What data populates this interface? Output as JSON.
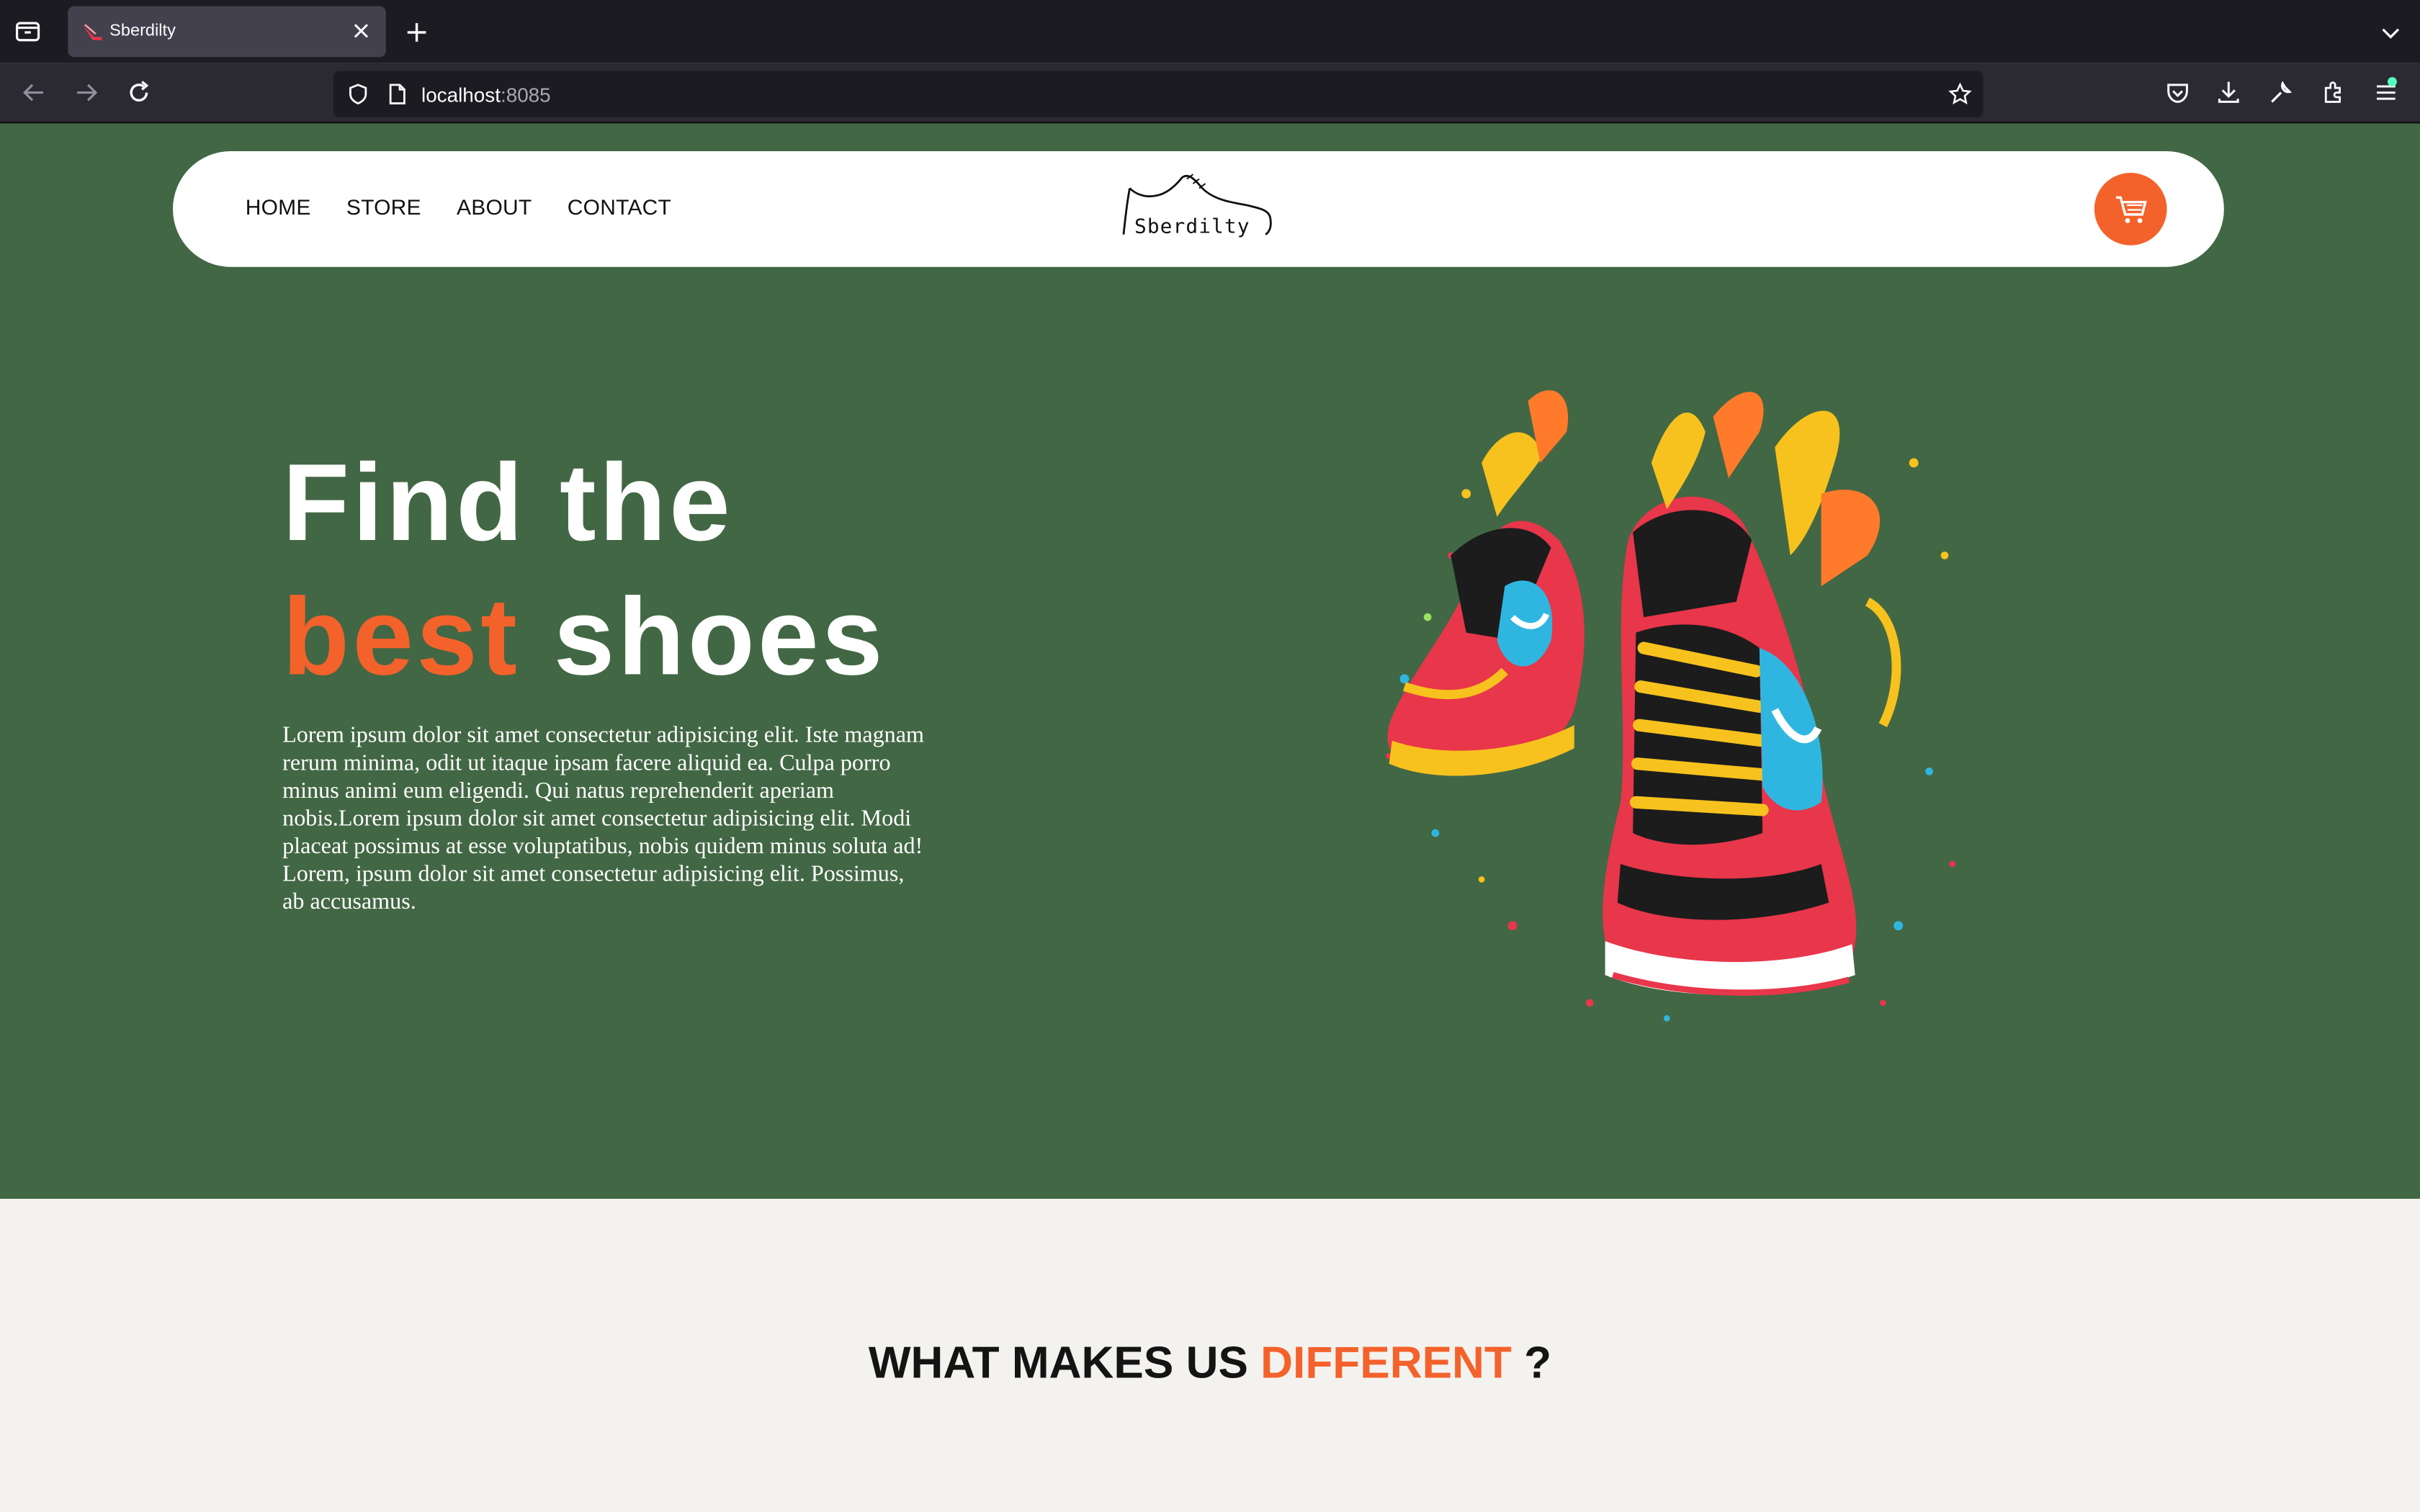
{
  "browser": {
    "tab_title": "Sberdilty",
    "url_host": "localhost",
    "url_port": ":8085"
  },
  "nav": {
    "links": [
      "HOME",
      "STORE",
      "ABOUT",
      "CONTACT"
    ],
    "logo_text": "Sberdilty",
    "cart_icon": "cart-icon"
  },
  "hero": {
    "line1": "Find the",
    "line2_accent": "best",
    "line2_rest": " shoes",
    "description": "Lorem ipsum dolor sit amet consectetur adipisicing elit. Iste magnam rerum minima, odit ut itaque ipsam facere aliquid ea. Culpa porro minus animi eum eligendi. Qui natus reprehenderit aperiam nobis.Lorem ipsum dolor sit amet consectetur adipisicing elit. Modi placeat possimus at esse voluptatibus, nobis quidem minus soluta ad! Lorem, ipsum dolor sit amet consectetur adipisicing elit. Possimus, ab accusamus."
  },
  "section": {
    "heading_start": "WHAT MAKES US ",
    "heading_accent": "DIFFERENT",
    "heading_end": " ?"
  },
  "colors": {
    "hero_bg": "#426744",
    "accent": "#f4622b",
    "section_bg": "#f4f2ef"
  }
}
